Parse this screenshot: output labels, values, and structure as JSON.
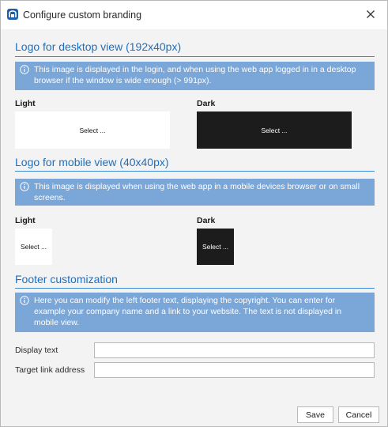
{
  "window": {
    "title": "Configure custom branding",
    "close_glyph": "✕"
  },
  "desktop": {
    "heading": "Logo for desktop view (192x40px)",
    "info": "This image is displayed in the login, and when using the web app logged in in a desktop browser if the window is wide enough (> 991px).",
    "light_label": "Light",
    "dark_label": "Dark",
    "light_select": "Select ...",
    "dark_select": "Select ..."
  },
  "mobile": {
    "heading": "Logo for mobile view (40x40px)",
    "info": "This image is displayed when using the web app in a mobile devices browser or on small screens.",
    "light_label": "Light",
    "dark_label": "Dark",
    "light_select": "Select ...",
    "dark_select": "Select ..."
  },
  "footer": {
    "heading": "Footer customization",
    "info": "Here you can modify the left footer text, displaying the copyright. You can enter for example your company name and a link to your website. The text is not displayed in mobile view.",
    "display_text_label": "Display text",
    "display_text_value": "",
    "target_link_label": "Target link address",
    "target_link_value": ""
  },
  "buttons": {
    "save": "Save",
    "cancel": "Cancel"
  },
  "colors": {
    "accent": "#1e6fbf",
    "info_bg": "#7aa6d8",
    "dark_tile": "#1c1c1c",
    "dialog_bg": "#f3f3f3"
  },
  "icons": {
    "app": "app-logo-icon",
    "info": "info-icon",
    "close": "close-icon"
  }
}
